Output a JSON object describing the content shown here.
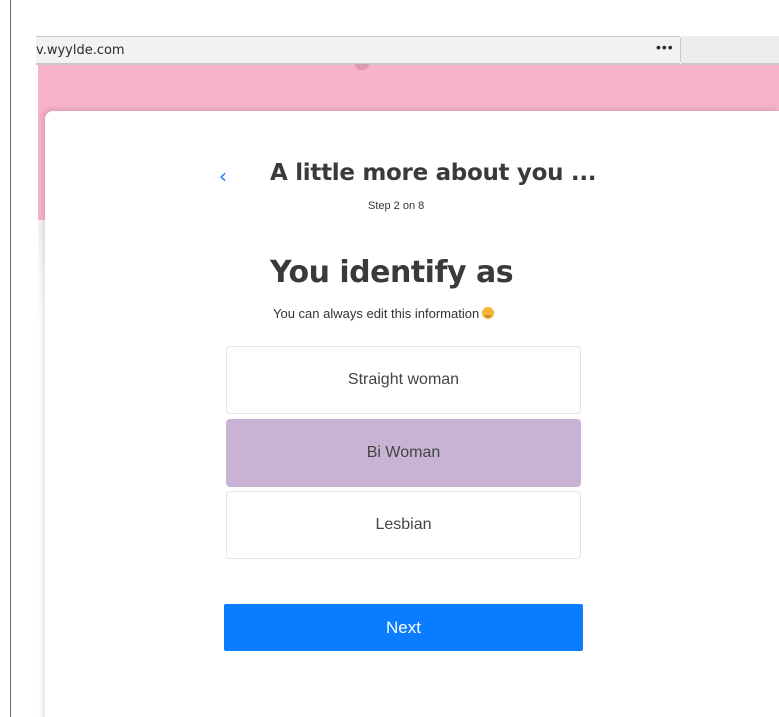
{
  "browser": {
    "url": "v.wyylde.com",
    "more_icon": "•••",
    "bookmark_icon": "☆"
  },
  "header": {
    "back_icon": "‹",
    "title": "A little more about you ...",
    "step": "Step 2 on 8"
  },
  "question": {
    "title": "You identify as",
    "subtitle": "You can always edit this information",
    "emoji": "smiling-face-icon"
  },
  "options": [
    {
      "label": "Straight woman",
      "selected": false
    },
    {
      "label": "Bi Woman",
      "selected": true
    },
    {
      "label": "Lesbian",
      "selected": false
    }
  ],
  "actions": {
    "next_label": "Next"
  },
  "colors": {
    "pink_band": "#f7b3cb",
    "selected_option": "#c9b3d4",
    "primary_button": "#0a7cff",
    "back_arrow": "#1877f2"
  }
}
